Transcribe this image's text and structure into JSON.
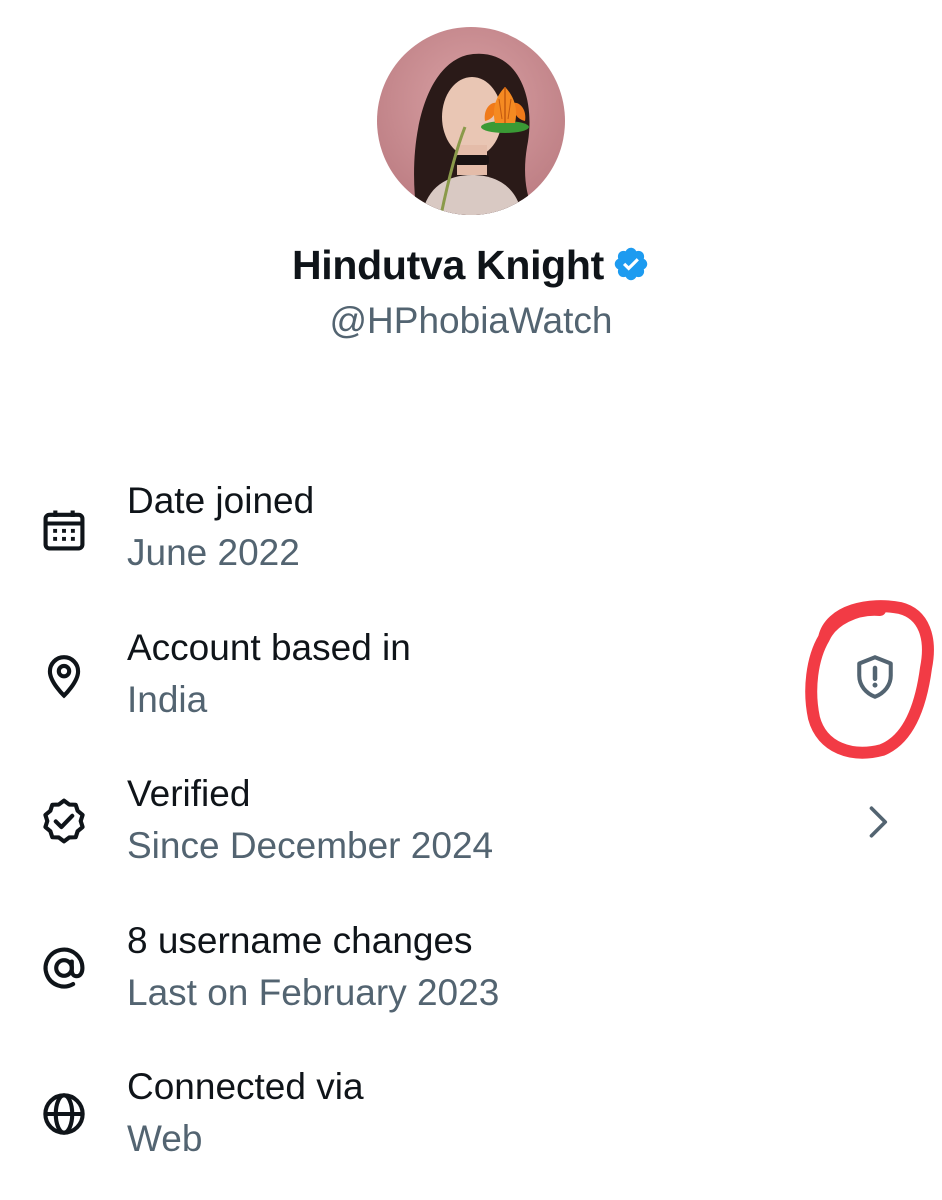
{
  "profile": {
    "display_name": "Hindutva Knight",
    "handle": "@HPhobiaWatch",
    "verified_badge_icon": "verified-check-badge",
    "avatar_icon": "profile-photo-with-lotus-flower"
  },
  "about": {
    "rows": [
      {
        "icon": "calendar-icon",
        "title": "Date joined",
        "value": "June 2022"
      },
      {
        "icon": "location-pin-icon",
        "title": "Account based in",
        "value": "India",
        "action_icon": "shield-alert-icon"
      },
      {
        "icon": "verified-badge-outline-icon",
        "title": "Verified",
        "value": "Since December 2024",
        "action_icon": "chevron-right-icon"
      },
      {
        "icon": "at-sign-icon",
        "title": "8 username changes",
        "value": "Last on February 2023"
      },
      {
        "icon": "globe-icon",
        "title": "Connected via",
        "value": "Web"
      }
    ]
  },
  "colors": {
    "text_primary": "#0f1419",
    "text_secondary": "#536471",
    "verified_blue": "#1d9bf0",
    "highlight_red": "#f23b45"
  }
}
